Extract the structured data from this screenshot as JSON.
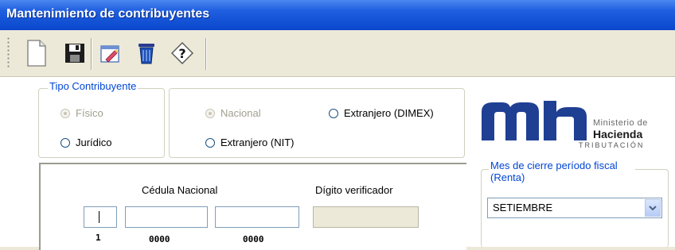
{
  "window": {
    "title": "Mantenimiento de contribuyentes"
  },
  "toolbar": {
    "buttons": [
      {
        "icon": "new-document-icon"
      },
      {
        "icon": "save-icon"
      },
      {
        "icon": "edit-icon"
      },
      {
        "icon": "delete-icon"
      },
      {
        "icon": "help-icon"
      }
    ]
  },
  "tipo_contribuyente": {
    "legend": "Tipo Contribuyente",
    "fisico": "Físico",
    "juridico": "Jurídico",
    "nacional": "Nacional",
    "extranjero_dimex": "Extranjero (DIMEX)",
    "extranjero_nit": "Extranjero (NIT)",
    "selected": "Físico",
    "origen_selected": "Nacional"
  },
  "identificacion": {
    "cedula_label": "Cédula Nacional",
    "digito_label": "Dígito verificador",
    "hint_1": "1",
    "hint_2": "0000",
    "hint_3": "0000",
    "value_1": "",
    "value_2": "",
    "value_3": "",
    "digito_value": ""
  },
  "logo": {
    "mark": "mh",
    "line1": "Ministerio de",
    "line2": "Hacienda",
    "line3": "TRIBUTACIÓN",
    "color": "#1f3f93"
  },
  "mes_cierre": {
    "legend": "Mes de cierre período fiscal (Renta)",
    "selected": "SETIEMBRE"
  },
  "colors": {
    "title_bar": "#0a47cc",
    "legend_text": "#0046d5"
  }
}
